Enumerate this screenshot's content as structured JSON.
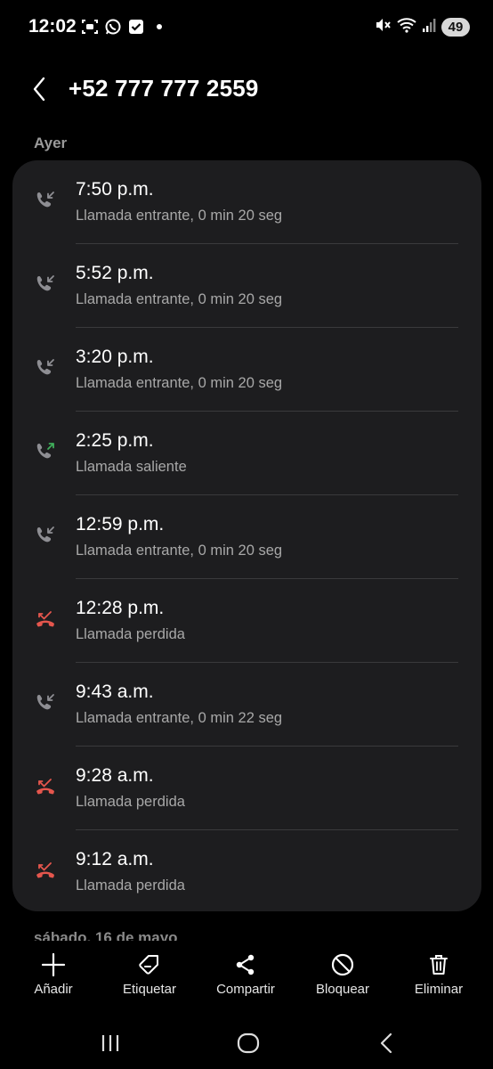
{
  "status_bar": {
    "time": "12:02",
    "battery": "49",
    "left_icons": [
      "screenshot-icon",
      "whatsapp-icon",
      "checkbox-icon",
      "dot-icon"
    ],
    "right_icons": [
      "mute-icon",
      "wifi-icon",
      "signal-icon"
    ]
  },
  "header": {
    "title": "+52 777 777 2559",
    "back_icon": "chevron-left-icon"
  },
  "section": {
    "label": "Ayer"
  },
  "calls": [
    {
      "time": "7:50 p.m.",
      "desc": "Llamada entrante, 0 min 20 seg",
      "type": "incoming"
    },
    {
      "time": "5:52 p.m.",
      "desc": "Llamada entrante, 0 min 20 seg",
      "type": "incoming"
    },
    {
      "time": "3:20 p.m.",
      "desc": "Llamada entrante, 0 min 20 seg",
      "type": "incoming"
    },
    {
      "time": "2:25 p.m.",
      "desc": "Llamada saliente",
      "type": "outgoing"
    },
    {
      "time": "12:59 p.m.",
      "desc": "Llamada entrante, 0 min 20 seg",
      "type": "incoming"
    },
    {
      "time": "12:28 p.m.",
      "desc": "Llamada perdida",
      "type": "missed"
    },
    {
      "time": "9:43 a.m.",
      "desc": "Llamada entrante, 0 min 22 seg",
      "type": "incoming"
    },
    {
      "time": "9:28 a.m.",
      "desc": "Llamada perdida",
      "type": "missed"
    },
    {
      "time": "9:12 a.m.",
      "desc": "Llamada perdida",
      "type": "missed"
    }
  ],
  "next_section": {
    "label": "sábado, 16 de mayo"
  },
  "actions": {
    "add": "Añadir",
    "tag": "Etiquetar",
    "share": "Compartir",
    "block": "Bloquear",
    "delete": "Eliminar"
  },
  "colors": {
    "background": "#000000",
    "card": "#1d1d1f",
    "incoming_icon": "#8e8e93",
    "outgoing_icon": "#3fae5a",
    "missed_icon": "#e5564d",
    "secondary_text": "#a8a8a8"
  }
}
